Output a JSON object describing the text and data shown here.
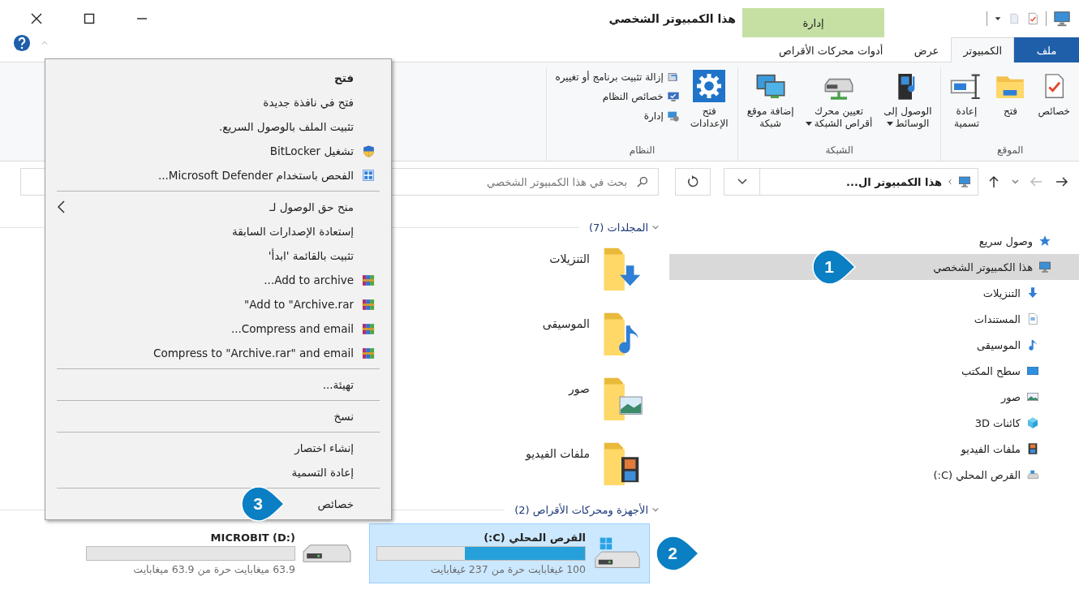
{
  "window": {
    "title": "هذا الكمبيوتر الشخصي"
  },
  "contextual_tab_group": {
    "label": "إدارة"
  },
  "ribbon_tabs": [
    {
      "label": "ملف",
      "kind": "file",
      "selected": false
    },
    {
      "label": "الكمبيوتر",
      "kind": "tab",
      "selected": true
    },
    {
      "label": "عرض",
      "kind": "tab",
      "selected": false
    },
    {
      "label": "أدوات محركات الأقراص",
      "kind": "tab",
      "selected": false
    }
  ],
  "ribbon_groups": [
    {
      "label": "الموقع",
      "buttons": [
        {
          "label": "خصائص",
          "kind": "properties",
          "dropdown": false
        },
        {
          "label": "فتح",
          "kind": "open",
          "dropdown": false
        },
        {
          "label": "إعادة\nتسمية",
          "kind": "rename",
          "dropdown": false
        }
      ]
    },
    {
      "label": "الشبكة",
      "buttons": [
        {
          "label": "الوصول إلى\nالوسائط",
          "kind": "media",
          "dropdown": true
        },
        {
          "label": "تعيين محرك\nأقراص الشبكة",
          "kind": "map-drive",
          "dropdown": true
        },
        {
          "label": "إضافة موقع\nشبكة",
          "kind": "network-location",
          "dropdown": false
        }
      ]
    },
    {
      "label": "النظام",
      "buttons": [
        {
          "label": "فتح\nالإعدادات",
          "kind": "settings",
          "dropdown": false
        }
      ],
      "small_buttons": [
        {
          "label": "إزالة تثبيت برنامج أو تغييره",
          "kind": "uninstall"
        },
        {
          "label": "خصائص النظام",
          "kind": "system"
        },
        {
          "label": "إدارة",
          "kind": "manage"
        }
      ]
    }
  ],
  "address_bar": {
    "path": "هذا الكمبيوتر ال..."
  },
  "search": {
    "placeholder": "بحث في هذا الكمبيوتر الشخصي"
  },
  "navigation": [
    {
      "label": "وصول سريع",
      "kind": "star",
      "selected": false
    },
    {
      "label": "هذا الكمبيوتر الشخصي",
      "kind": "pc",
      "selected": true,
      "callout": "1",
      "children": [
        {
          "label": "التنزيلات",
          "kind": "downloads",
          "selected": false
        },
        {
          "label": "المستندات",
          "kind": "documents",
          "selected": false
        },
        {
          "label": "الموسيقى",
          "kind": "music",
          "selected": false
        },
        {
          "label": "سطح المكتب",
          "kind": "desktop",
          "selected": false
        },
        {
          "label": "صور",
          "kind": "pictures",
          "selected": false
        },
        {
          "label": "كائنات 3D",
          "kind": "objects",
          "selected": false
        },
        {
          "label": "ملفات الفيديو",
          "kind": "videos",
          "selected": false
        },
        {
          "label": "القرص المحلي (C:)",
          "kind": "drive",
          "selected": false
        }
      ]
    }
  ],
  "folders_group": {
    "label": "المجلدات (7)",
    "expanded": true
  },
  "folders": [
    {
      "label": "التنزيلات",
      "kind": "downloads"
    },
    {
      "label": "الموسيقى",
      "kind": "music"
    },
    {
      "label": "صور",
      "kind": "pictures"
    },
    {
      "label": "ملفات الفيديو",
      "kind": "videos"
    }
  ],
  "drives_group": {
    "label": "الأجهزة ومحركات الأقراص (2)",
    "expanded": true
  },
  "drives": [
    {
      "name": "القرص المحلي (C:)",
      "kind": "system",
      "level": 0.58,
      "free_space": "100 غيغابايت حرة من 237 غيغابايت",
      "selected": true,
      "callout": "2"
    },
    {
      "name": "MICROBIT (D:)",
      "kind": "removable",
      "free_space": "63.9 ميغابايت حرة من 63.9 ميغابايت",
      "selected": false
    }
  ],
  "context_menu": {
    "items": [
      {
        "label": "فتح",
        "kind": "default"
      },
      {
        "label": "فتح في نافذة جديدة",
        "kind": "plain"
      },
      {
        "label": "تثبيت الملف بالوصول السريع.",
        "kind": "plain"
      },
      {
        "label": "تشغيل BitLocker",
        "kind": "shield"
      },
      {
        "label": "الفحص باستخدام Microsoft Defender...",
        "kind": "defender"
      },
      {
        "kind": "separator"
      },
      {
        "label": "منح حق الوصول لـ",
        "kind": "submenu"
      },
      {
        "label": "إستعادة الإصدارات السابقة",
        "kind": "plain"
      },
      {
        "label": "تثبيت بالقائمة 'ابدأ'",
        "kind": "plain"
      },
      {
        "label": "Add to archive...",
        "kind": "archive"
      },
      {
        "label": "Add to \"Archive.rar\"",
        "kind": "archive"
      },
      {
        "label": "Compress and email...",
        "kind": "archive"
      },
      {
        "label": "Compress to \"Archive.rar\" and email",
        "kind": "archive"
      },
      {
        "kind": "separator"
      },
      {
        "label": "تهيئة...",
        "kind": "plain"
      },
      {
        "kind": "separator"
      },
      {
        "label": "نسخ",
        "kind": "plain"
      },
      {
        "kind": "separator"
      },
      {
        "label": "إنشاء اختصار",
        "kind": "plain"
      },
      {
        "label": "إعادة التسمية",
        "kind": "plain"
      },
      {
        "kind": "separator"
      },
      {
        "label": "خصائص",
        "kind": "plain",
        "callout": "3"
      }
    ]
  }
}
